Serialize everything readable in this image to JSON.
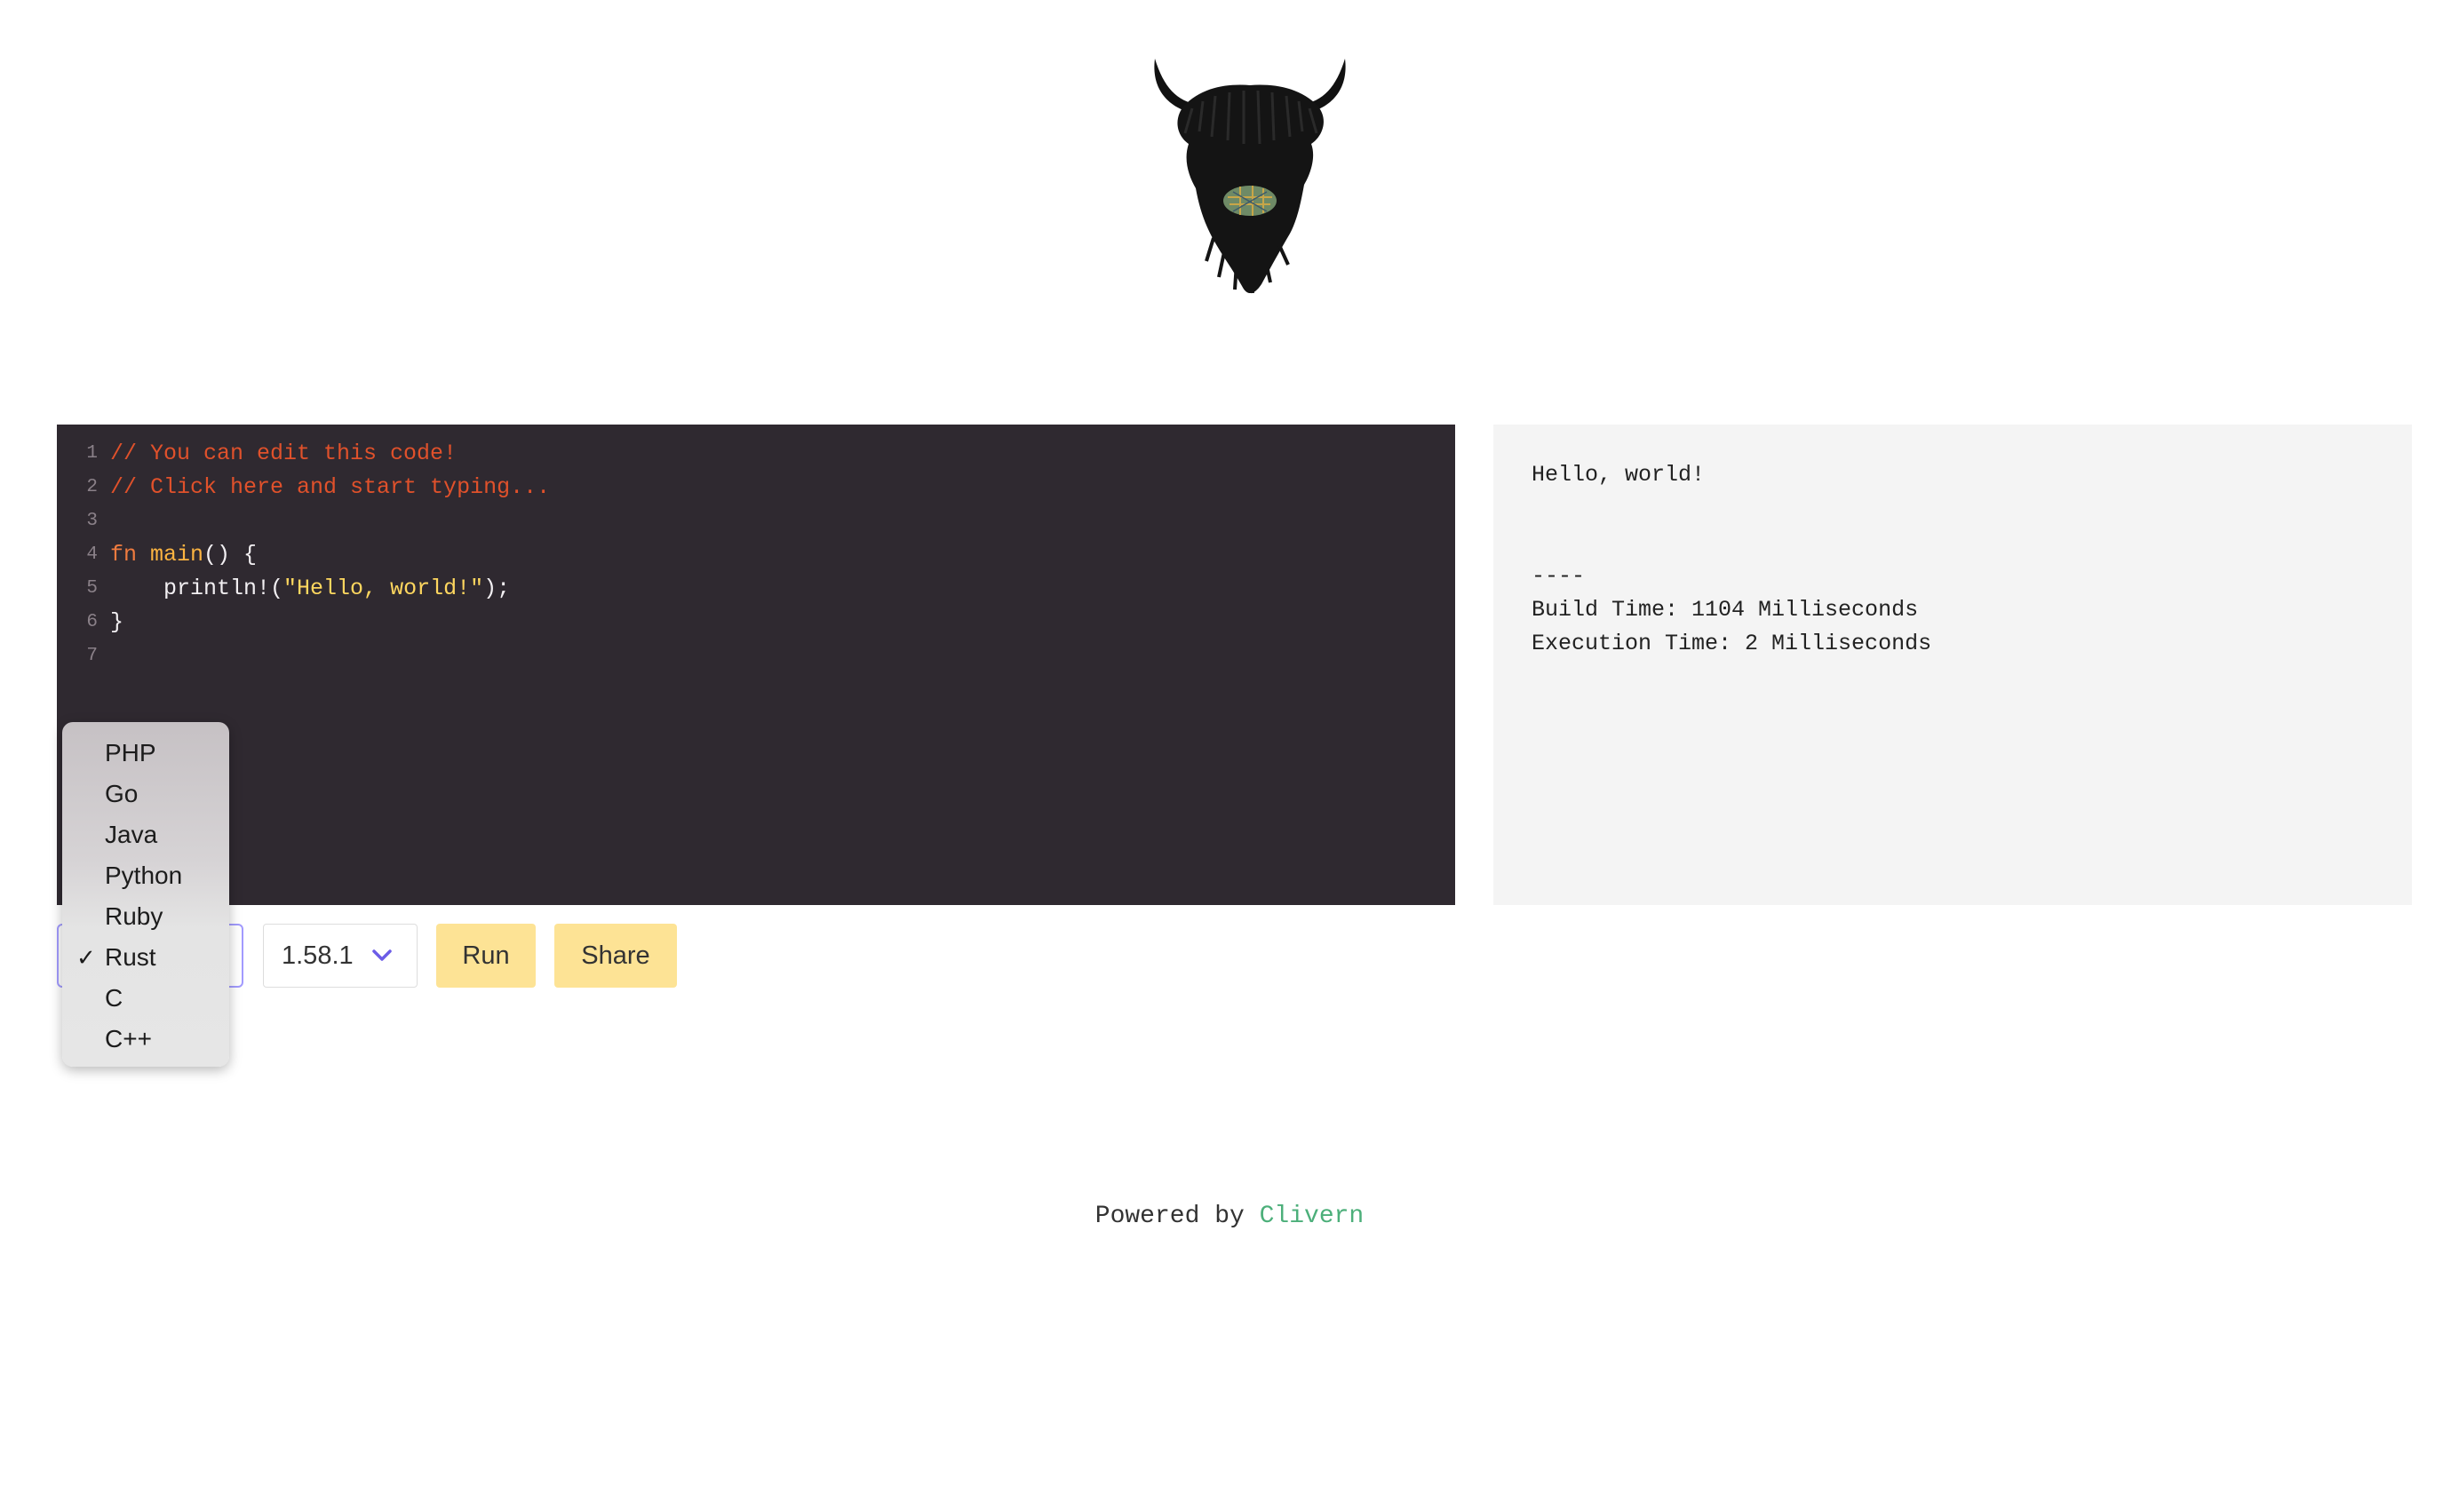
{
  "editor": {
    "lines": [
      {
        "num": "1",
        "text": "// You can edit this code!"
      },
      {
        "num": "2",
        "text": "// Click here and start typing..."
      },
      {
        "num": "3",
        "text": ""
      },
      {
        "num": "4",
        "kw": "fn",
        "name": "main",
        "rest": "() {"
      },
      {
        "num": "5",
        "indent": "    ",
        "call": "println!(",
        "str": "\"Hello, world!\"",
        "end": ");"
      },
      {
        "num": "6",
        "text": "}"
      },
      {
        "num": "7",
        "text": ""
      }
    ]
  },
  "output": {
    "lines": [
      "Hello, world!",
      "",
      "",
      "----",
      "Build Time: 1104 Milliseconds",
      "Execution Time: 2 Milliseconds"
    ]
  },
  "language_dropdown": {
    "options": [
      "PHP",
      "Go",
      "Java",
      "Python",
      "Ruby",
      "Rust",
      "C",
      "C++"
    ],
    "selected": "Rust",
    "check": "✓"
  },
  "version_select": {
    "value": "1.58.1"
  },
  "buttons": {
    "run": "Run",
    "share": "Share"
  },
  "footer": {
    "prefix": "Powered by ",
    "link": "Clivern"
  },
  "colors": {
    "editor_bg": "#2f2930",
    "button_bg": "#fde395",
    "link": "#4caf7a",
    "select_focus": "#a29bfe"
  },
  "icons": {
    "logo": "highland-cow-logo",
    "version_chevron": "chevron-down-icon",
    "selected_check": "checkmark-icon"
  }
}
